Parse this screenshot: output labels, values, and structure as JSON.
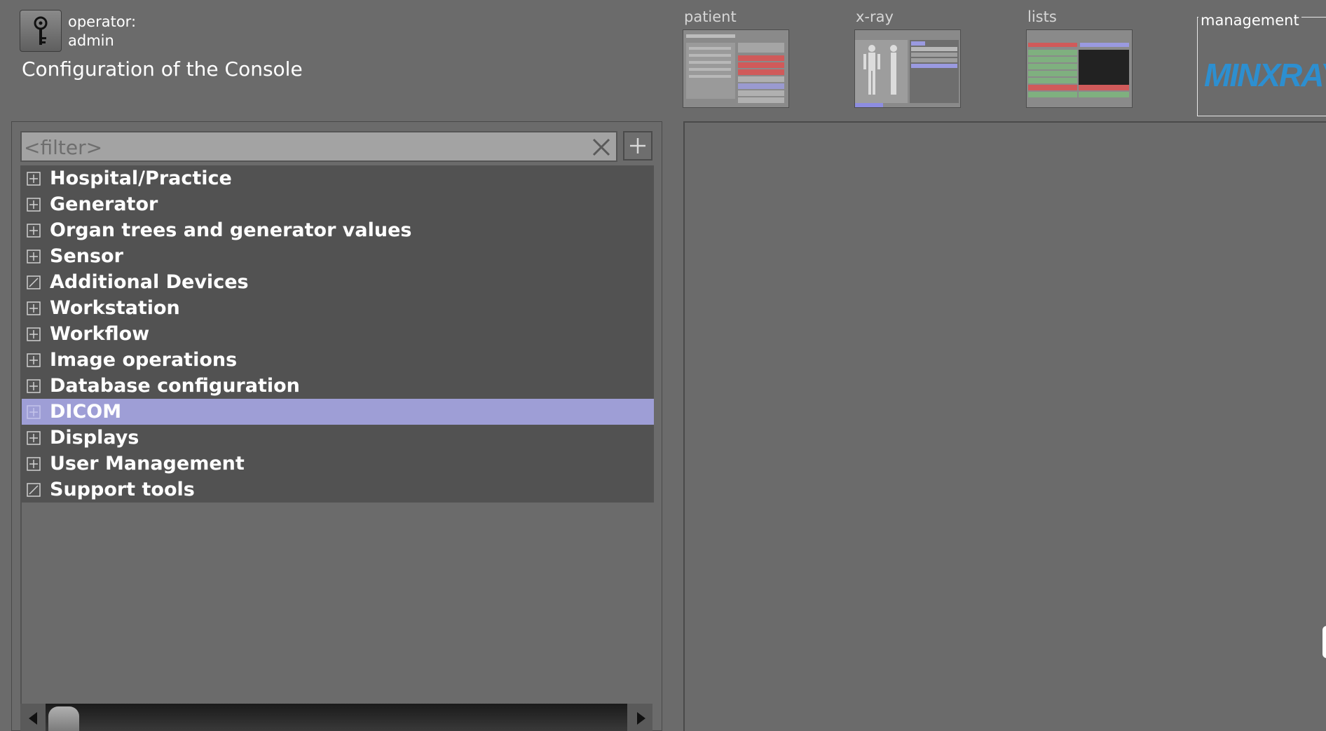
{
  "header": {
    "operator_label": "operator:",
    "operator_name": "admin",
    "title": "Configuration of the Console"
  },
  "nav_tabs": [
    {
      "label": "patient",
      "active": false
    },
    {
      "label": "x-ray",
      "active": false
    },
    {
      "label": "lists",
      "active": false
    },
    {
      "label": "management",
      "active": true
    }
  ],
  "logo_text": "MINXRAY",
  "filter": {
    "placeholder": "<filter>",
    "value": ""
  },
  "tree_items": [
    {
      "label": "Hospital/Practice",
      "expander": "plus"
    },
    {
      "label": "Generator",
      "expander": "plus"
    },
    {
      "label": "Organ trees and generator values",
      "expander": "plus"
    },
    {
      "label": "Sensor",
      "expander": "plus"
    },
    {
      "label": "Additional Devices",
      "expander": "leaf"
    },
    {
      "label": "Workstation",
      "expander": "plus"
    },
    {
      "label": "Workflow",
      "expander": "plus"
    },
    {
      "label": "Image operations",
      "expander": "plus"
    },
    {
      "label": "Database configuration",
      "expander": "plus"
    },
    {
      "label": "DICOM",
      "expander": "plus",
      "selected": true
    },
    {
      "label": "Displays",
      "expander": "plus"
    },
    {
      "label": "User Management",
      "expander": "plus"
    },
    {
      "label": "Support tools",
      "expander": "leaf"
    }
  ],
  "colors": {
    "background": "#6b6b6b",
    "tree_background": "#525252",
    "selected_row": "#9e9ed6",
    "logo": "#2d8fd0"
  }
}
